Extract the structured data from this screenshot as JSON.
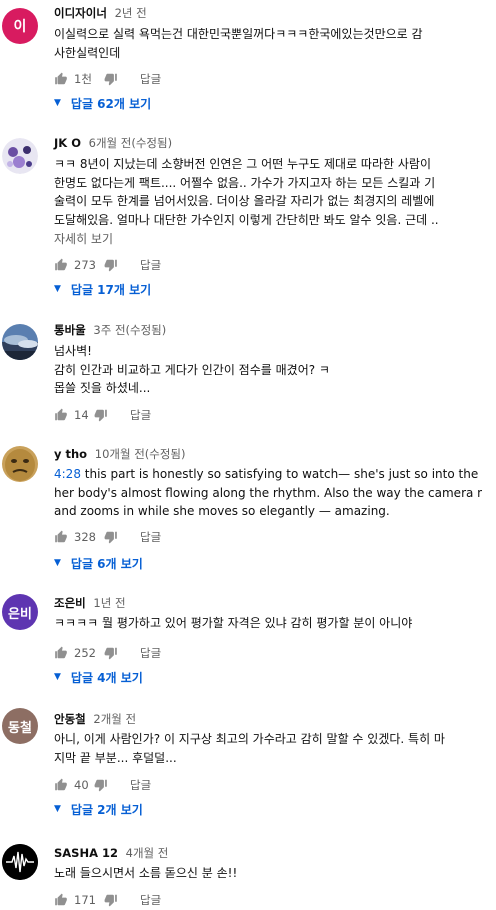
{
  "comments": [
    {
      "avatar_text": "이",
      "avatar_color": "#d81b60",
      "author": "이디자이너",
      "time": "2년 전",
      "lines": [
        "이실력으로 실력 욕먹는건 대한민국뿐일꺼다ㅋㅋㅋ한국에있는것만으로 감",
        "사한실력인데"
      ],
      "likes": "1천",
      "reply_label": "답글",
      "replies": "답글 62개 보기"
    },
    {
      "avatar_text": "",
      "author": "JK O",
      "time": "6개월 전(수정됨)",
      "lines": [
        "ㅋㅋ 8년이 지났는데 소향버전 인연은 그 어떤 누구도 제대로 따라한 사람이",
        "한명도 없다는게 팩트.... 어쩔수 없음.. 가수가 가지고자 하는 모든 스킬과 기",
        "술력이 모두 한계를 넘어서있음.  더이상 올라갈 자리가 없는 최경지의 레벨에",
        "도달해있음. 얼마나 대단한 가수인지 이렇게 간단히만 봐도 알수 잇음.  근데 .."
      ],
      "more": "자세히 보기",
      "likes": "273",
      "reply_label": "답글",
      "replies": "답글 17개 보기"
    },
    {
      "avatar_text": "",
      "author": "통바울",
      "time": "3주 전(수정됨)",
      "lines": [
        "넘사벽!",
        "감히 인간과 비교하고 게다가 인간이 점수를 매겼어? ㅋ",
        "몹쓸 짓을 하셨네..."
      ],
      "likes": "14",
      "reply_label": "답글"
    },
    {
      "avatar_text": "",
      "author": "y tho",
      "time": "10개월 전(수정됨)",
      "timestamp_link": "4:28",
      "lines": [
        " this part is honestly so satisfying to watch— she's just so into the song,",
        "her body's almost flowing along the rhythm. Also the way the camera moves",
        "and zooms in while she moves so elegantly — amazing."
      ],
      "likes": "328",
      "reply_label": "답글",
      "replies": "답글 6개 보기"
    },
    {
      "avatar_text": "은비",
      "avatar_color": "#5e35b1",
      "author": "조은비",
      "time": "1년 전",
      "lines": [
        "ㅋㅋㅋㅋ 뭘 평가하고 있어 평가할 자격은 있냐 감히 평가할 분이 아니야"
      ],
      "likes": "252",
      "reply_label": "답글",
      "replies": "답글 4개 보기"
    },
    {
      "avatar_text": "동철",
      "avatar_color": "#8d6e63",
      "author": "안동철",
      "time": "2개월 전",
      "lines": [
        "아니, 이게 사람인가? 이 지구상 최고의 가수라고 감히 말할 수 있겠다. 특히 마",
        "지막 끝 부분... 후덜덜..."
      ],
      "likes": "40",
      "reply_label": "답글",
      "replies": "답글 2개 보기"
    },
    {
      "avatar_text": "",
      "author": "SASHA 12",
      "time": "4개월 전",
      "lines": [
        "노래 들으시면서 소름 돋으신 분 손!!"
      ],
      "likes": "171",
      "reply_label": "답글"
    }
  ]
}
